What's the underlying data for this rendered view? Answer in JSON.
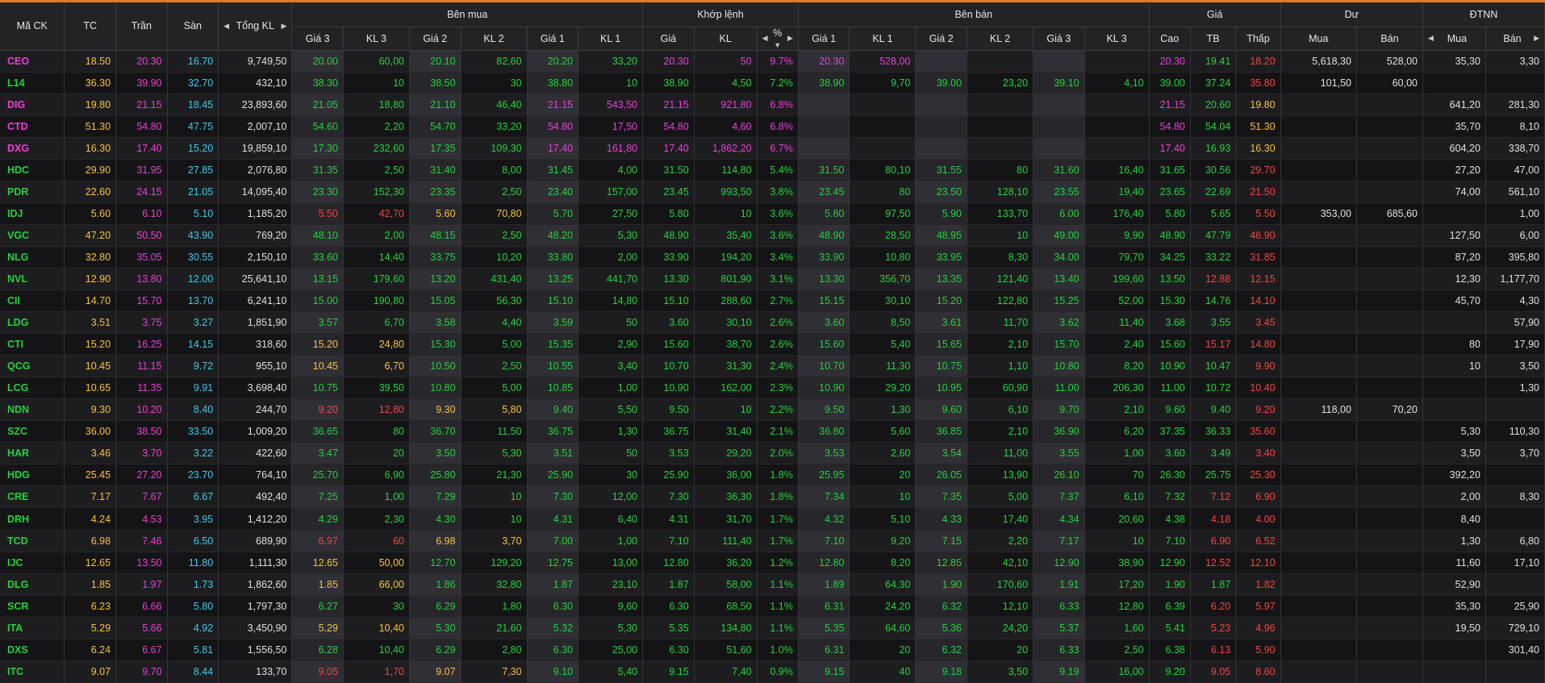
{
  "colors": {
    "ceiling": "#ee3dd9",
    "floor": "#3fc9e8",
    "ref": "#f7c23c",
    "up": "#26d13b",
    "down": "#f0463f",
    "accent": "#e8761f"
  },
  "headers": {
    "symbol": "Mã CK",
    "ref": "TC",
    "ceil": "Trần",
    "floor": "Sàn",
    "total": "Tổng KL",
    "buy": "Bên mua",
    "match": "Khớp lệnh",
    "sell": "Bên bán",
    "price": "Giá",
    "remain": "Dư",
    "foreign": "ĐTNN",
    "buy_cols": [
      "Giá 3",
      "KL 3",
      "Giá 2",
      "KL 2",
      "Giá 1",
      "KL 1"
    ],
    "match_cols": [
      "Giá",
      "KL",
      "%"
    ],
    "sell_cols": [
      "Giá 1",
      "KL 1",
      "Giá 2",
      "KL 2",
      "Giá 3",
      "KL 3"
    ],
    "price_cols": [
      "Cao",
      "TB",
      "Thấp"
    ],
    "remain_cols": [
      "Mua",
      "Bán"
    ],
    "foreign_cols": [
      "Mua",
      "Bán"
    ]
  },
  "rows": [
    {
      "s": "CEO",
      "tc": "18.50",
      "ce": "20.30",
      "fl": "16.70",
      "tot": "9,749,50",
      "b3": "20.00",
      "bk3": "60,00",
      "b2": "20.10",
      "bk2": "82,60",
      "b1": "20.20",
      "bk1": "33,20",
      "mp": "20.30",
      "mk": "50",
      "pct": "9.7%",
      "s1": "20.30",
      "sk1": "528,00",
      "s2": "",
      "sk2": "",
      "s3": "",
      "sk3": "",
      "hi": "20.30",
      "av": "19.41",
      "lo": "18.20",
      "rb": "5,618,30",
      "rs": "528,00",
      "fb": "35,30",
      "fs": "3,30"
    },
    {
      "s": "L14",
      "tc": "36.30",
      "ce": "39.90",
      "fl": "32.70",
      "tot": "432,10",
      "b3": "38.30",
      "bk3": "10",
      "b2": "38.50",
      "bk2": "30",
      "b1": "38.80",
      "bk1": "10",
      "mp": "38.90",
      "mk": "4,50",
      "pct": "7.2%",
      "s1": "38.90",
      "sk1": "9,70",
      "s2": "39.00",
      "sk2": "23,20",
      "s3": "39.10",
      "sk3": "4,10",
      "hi": "39.00",
      "av": "37.24",
      "lo": "35.80",
      "rb": "101,50",
      "rs": "60,00",
      "fb": "",
      "fs": ""
    },
    {
      "s": "DIG",
      "tc": "19.80",
      "ce": "21.15",
      "fl": "18.45",
      "tot": "23,893,60",
      "b3": "21.05",
      "bk3": "18,80",
      "b2": "21.10",
      "bk2": "46,40",
      "b1": "21.15",
      "bk1": "543,50",
      "mp": "21.15",
      "mk": "921,80",
      "pct": "6.8%",
      "s1": "",
      "sk1": "",
      "s2": "",
      "sk2": "",
      "s3": "",
      "sk3": "",
      "hi": "21.15",
      "av": "20.60",
      "lo": "19.80",
      "rb": "",
      "rs": "",
      "fb": "641,20",
      "fs": "281,30"
    },
    {
      "s": "CTD",
      "tc": "51.30",
      "ce": "54.80",
      "fl": "47.75",
      "tot": "2,007,10",
      "b3": "54.60",
      "bk3": "2,20",
      "b2": "54.70",
      "bk2": "33,20",
      "b1": "54.80",
      "bk1": "17,50",
      "mp": "54.80",
      "mk": "4,60",
      "pct": "6.8%",
      "s1": "",
      "sk1": "",
      "s2": "",
      "sk2": "",
      "s3": "",
      "sk3": "",
      "hi": "54.80",
      "av": "54.04",
      "lo": "51.30",
      "rb": "",
      "rs": "",
      "fb": "35,70",
      "fs": "8,10"
    },
    {
      "s": "DXG",
      "tc": "16.30",
      "ce": "17.40",
      "fl": "15.20",
      "tot": "19,859,10",
      "b3": "17.30",
      "bk3": "232,60",
      "b2": "17.35",
      "bk2": "109,30",
      "b1": "17.40",
      "bk1": "161,80",
      "mp": "17.40",
      "mk": "1,862,20",
      "pct": "6.7%",
      "s1": "",
      "sk1": "",
      "s2": "",
      "sk2": "",
      "s3": "",
      "sk3": "",
      "hi": "17.40",
      "av": "16.93",
      "lo": "16.30",
      "rb": "",
      "rs": "",
      "fb": "604,20",
      "fs": "338,70"
    },
    {
      "s": "HDC",
      "tc": "29.90",
      "ce": "31.95",
      "fl": "27.85",
      "tot": "2,076,80",
      "b3": "31.35",
      "bk3": "2,50",
      "b2": "31.40",
      "bk2": "8,00",
      "b1": "31.45",
      "bk1": "4,00",
      "mp": "31.50",
      "mk": "114,80",
      "pct": "5.4%",
      "s1": "31.50",
      "sk1": "80,10",
      "s2": "31.55",
      "sk2": "80",
      "s3": "31.60",
      "sk3": "16,40",
      "hi": "31.65",
      "av": "30.56",
      "lo": "29.70",
      "rb": "",
      "rs": "",
      "fb": "27,20",
      "fs": "47,00"
    },
    {
      "s": "PDR",
      "tc": "22.60",
      "ce": "24.15",
      "fl": "21.05",
      "tot": "14,095,40",
      "b3": "23.30",
      "bk3": "152,30",
      "b2": "23.35",
      "bk2": "2,50",
      "b1": "23.40",
      "bk1": "157,00",
      "mp": "23.45",
      "mk": "993,50",
      "pct": "3.8%",
      "s1": "23.45",
      "sk1": "80",
      "s2": "23.50",
      "sk2": "128,10",
      "s3": "23.55",
      "sk3": "19,40",
      "hi": "23.65",
      "av": "22.69",
      "lo": "21.50",
      "rb": "",
      "rs": "",
      "fb": "74,00",
      "fs": "561,10"
    },
    {
      "s": "IDJ",
      "tc": "5.60",
      "ce": "6.10",
      "fl": "5.10",
      "tot": "1,185,20",
      "b3": "5.50",
      "bk3": "42,70",
      "b2": "5.60",
      "bk2": "70,80",
      "b1": "5.70",
      "bk1": "27,50",
      "mp": "5.80",
      "mk": "10",
      "pct": "3.6%",
      "s1": "5.80",
      "sk1": "97,50",
      "s2": "5.90",
      "sk2": "133,70",
      "s3": "6.00",
      "sk3": "176,40",
      "hi": "5.80",
      "av": "5.65",
      "lo": "5.50",
      "rb": "353,00",
      "rs": "685,60",
      "fb": "",
      "fs": "1,00"
    },
    {
      "s": "VGC",
      "tc": "47.20",
      "ce": "50.50",
      "fl": "43.90",
      "tot": "769,20",
      "b3": "48.10",
      "bk3": "2,00",
      "b2": "48.15",
      "bk2": "2,50",
      "b1": "48.20",
      "bk1": "5,30",
      "mp": "48.90",
      "mk": "35,40",
      "pct": "3.6%",
      "s1": "48.90",
      "sk1": "28,50",
      "s2": "48.95",
      "sk2": "10",
      "s3": "49.00",
      "sk3": "9,90",
      "hi": "48.90",
      "av": "47.79",
      "lo": "46.90",
      "rb": "",
      "rs": "",
      "fb": "127,50",
      "fs": "6,00"
    },
    {
      "s": "NLG",
      "tc": "32.80",
      "ce": "35.05",
      "fl": "30.55",
      "tot": "2,150,10",
      "b3": "33.60",
      "bk3": "14,40",
      "b2": "33.75",
      "bk2": "10,20",
      "b1": "33.80",
      "bk1": "2,00",
      "mp": "33.90",
      "mk": "194,20",
      "pct": "3.4%",
      "s1": "33.90",
      "sk1": "10,80",
      "s2": "33.95",
      "sk2": "8,30",
      "s3": "34.00",
      "sk3": "79,70",
      "hi": "34.25",
      "av": "33.22",
      "lo": "31.85",
      "rb": "",
      "rs": "",
      "fb": "87,20",
      "fs": "395,80"
    },
    {
      "s": "NVL",
      "tc": "12.90",
      "ce": "13.80",
      "fl": "12.00",
      "tot": "25,641,10",
      "b3": "13.15",
      "bk3": "179,60",
      "b2": "13.20",
      "bk2": "431,40",
      "b1": "13.25",
      "bk1": "441,70",
      "mp": "13.30",
      "mk": "801,90",
      "pct": "3.1%",
      "s1": "13.30",
      "sk1": "356,70",
      "s2": "13.35",
      "sk2": "121,40",
      "s3": "13.40",
      "sk3": "199,60",
      "hi": "13.50",
      "av": "12.88",
      "lo": "12.15",
      "rb": "",
      "rs": "",
      "fb": "12,30",
      "fs": "1,177,70"
    },
    {
      "s": "CII",
      "tc": "14.70",
      "ce": "15.70",
      "fl": "13.70",
      "tot": "6,241,10",
      "b3": "15.00",
      "bk3": "190,80",
      "b2": "15.05",
      "bk2": "56,30",
      "b1": "15.10",
      "bk1": "14,80",
      "mp": "15.10",
      "mk": "288,60",
      "pct": "2.7%",
      "s1": "15.15",
      "sk1": "30,10",
      "s2": "15.20",
      "sk2": "122,80",
      "s3": "15.25",
      "sk3": "52,00",
      "hi": "15.30",
      "av": "14.76",
      "lo": "14.10",
      "rb": "",
      "rs": "",
      "fb": "45,70",
      "fs": "4,30"
    },
    {
      "s": "LDG",
      "tc": "3.51",
      "ce": "3.75",
      "fl": "3.27",
      "tot": "1,851,90",
      "b3": "3.57",
      "bk3": "6,70",
      "b2": "3.58",
      "bk2": "4,40",
      "b1": "3.59",
      "bk1": "50",
      "mp": "3.60",
      "mk": "30,10",
      "pct": "2.6%",
      "s1": "3.60",
      "sk1": "8,50",
      "s2": "3.61",
      "sk2": "11,70",
      "s3": "3.62",
      "sk3": "11,40",
      "hi": "3.68",
      "av": "3.55",
      "lo": "3.45",
      "rb": "",
      "rs": "",
      "fb": "",
      "fs": "57,90"
    },
    {
      "s": "CTI",
      "tc": "15.20",
      "ce": "16.25",
      "fl": "14.15",
      "tot": "318,60",
      "b3": "15.20",
      "bk3": "24,80",
      "b2": "15.30",
      "bk2": "5,00",
      "b1": "15.35",
      "bk1": "2,90",
      "mp": "15.60",
      "mk": "38,70",
      "pct": "2.6%",
      "s1": "15.60",
      "sk1": "5,40",
      "s2": "15.65",
      "sk2": "2,10",
      "s3": "15.70",
      "sk3": "2,40",
      "hi": "15.60",
      "av": "15.17",
      "lo": "14.80",
      "rb": "",
      "rs": "",
      "fb": "80",
      "fs": "17,90"
    },
    {
      "s": "QCG",
      "tc": "10.45",
      "ce": "11.15",
      "fl": "9.72",
      "tot": "955,10",
      "b3": "10.45",
      "bk3": "6,70",
      "b2": "10.50",
      "bk2": "2,50",
      "b1": "10.55",
      "bk1": "3,40",
      "mp": "10.70",
      "mk": "31,30",
      "pct": "2.4%",
      "s1": "10.70",
      "sk1": "11,30",
      "s2": "10.75",
      "sk2": "1,10",
      "s3": "10.80",
      "sk3": "8,20",
      "hi": "10.90",
      "av": "10.47",
      "lo": "9.90",
      "rb": "",
      "rs": "",
      "fb": "10",
      "fs": "3,50"
    },
    {
      "s": "LCG",
      "tc": "10.65",
      "ce": "11.35",
      "fl": "9.91",
      "tot": "3,698,40",
      "b3": "10.75",
      "bk3": "39,50",
      "b2": "10.80",
      "bk2": "5,00",
      "b1": "10.85",
      "bk1": "1,00",
      "mp": "10.90",
      "mk": "162,00",
      "pct": "2.3%",
      "s1": "10.90",
      "sk1": "29,20",
      "s2": "10.95",
      "sk2": "60,90",
      "s3": "11.00",
      "sk3": "206,30",
      "hi": "11.00",
      "av": "10.72",
      "lo": "10.40",
      "rb": "",
      "rs": "",
      "fb": "",
      "fs": "1,30"
    },
    {
      "s": "NDN",
      "tc": "9.30",
      "ce": "10.20",
      "fl": "8.40",
      "tot": "244,70",
      "b3": "9.20",
      "bk3": "12,80",
      "b2": "9.30",
      "bk2": "5,80",
      "b1": "9.40",
      "bk1": "5,50",
      "mp": "9.50",
      "mk": "10",
      "pct": "2.2%",
      "s1": "9.50",
      "sk1": "1,30",
      "s2": "9.60",
      "sk2": "6,10",
      "s3": "9.70",
      "sk3": "2,10",
      "hi": "9.60",
      "av": "9.40",
      "lo": "9.20",
      "rb": "118,00",
      "rs": "70,20",
      "fb": "",
      "fs": ""
    },
    {
      "s": "SZC",
      "tc": "36.00",
      "ce": "38.50",
      "fl": "33.50",
      "tot": "1,009,20",
      "b3": "36.65",
      "bk3": "80",
      "b2": "36.70",
      "bk2": "11,50",
      "b1": "36.75",
      "bk1": "1,30",
      "mp": "36.75",
      "mk": "31,40",
      "pct": "2.1%",
      "s1": "36.80",
      "sk1": "5,60",
      "s2": "36.85",
      "sk2": "2,10",
      "s3": "36.90",
      "sk3": "6,20",
      "hi": "37.35",
      "av": "36.33",
      "lo": "35.60",
      "rb": "",
      "rs": "",
      "fb": "5,30",
      "fs": "110,30"
    },
    {
      "s": "HAR",
      "tc": "3.46",
      "ce": "3.70",
      "fl": "3.22",
      "tot": "422,60",
      "b3": "3.47",
      "bk3": "20",
      "b2": "3.50",
      "bk2": "5,30",
      "b1": "3.51",
      "bk1": "50",
      "mp": "3.53",
      "mk": "29,20",
      "pct": "2.0%",
      "s1": "3.53",
      "sk1": "2,60",
      "s2": "3.54",
      "sk2": "11,00",
      "s3": "3.55",
      "sk3": "1,00",
      "hi": "3.60",
      "av": "3.49",
      "lo": "3.40",
      "rb": "",
      "rs": "",
      "fb": "3,50",
      "fs": "3,70"
    },
    {
      "s": "HDG",
      "tc": "25.45",
      "ce": "27.20",
      "fl": "23.70",
      "tot": "764,10",
      "b3": "25.70",
      "bk3": "6,90",
      "b2": "25.80",
      "bk2": "21,30",
      "b1": "25.90",
      "bk1": "30",
      "mp": "25.90",
      "mk": "36,00",
      "pct": "1.8%",
      "s1": "25.95",
      "sk1": "20",
      "s2": "26.05",
      "sk2": "13,90",
      "s3": "26.10",
      "sk3": "70",
      "hi": "26.30",
      "av": "25.75",
      "lo": "25.30",
      "rb": "",
      "rs": "",
      "fb": "392,20",
      "fs": ""
    },
    {
      "s": "CRE",
      "tc": "7.17",
      "ce": "7.67",
      "fl": "6.67",
      "tot": "492,40",
      "b3": "7.25",
      "bk3": "1,00",
      "b2": "7.29",
      "bk2": "10",
      "b1": "7.30",
      "bk1": "12,00",
      "mp": "7.30",
      "mk": "36,30",
      "pct": "1.8%",
      "s1": "7.34",
      "sk1": "10",
      "s2": "7.35",
      "sk2": "5,00",
      "s3": "7.37",
      "sk3": "6,10",
      "hi": "7.32",
      "av": "7.12",
      "lo": "6.90",
      "rb": "",
      "rs": "",
      "fb": "2,00",
      "fs": "8,30"
    },
    {
      "s": "DRH",
      "tc": "4.24",
      "ce": "4.53",
      "fl": "3.95",
      "tot": "1,412,20",
      "b3": "4.29",
      "bk3": "2,30",
      "b2": "4.30",
      "bk2": "10",
      "b1": "4.31",
      "bk1": "6,40",
      "mp": "4.31",
      "mk": "31,70",
      "pct": "1.7%",
      "s1": "4.32",
      "sk1": "5,10",
      "s2": "4.33",
      "sk2": "17,40",
      "s3": "4.34",
      "sk3": "20,60",
      "hi": "4.38",
      "av": "4.18",
      "lo": "4.00",
      "rb": "",
      "rs": "",
      "fb": "8,40",
      "fs": ""
    },
    {
      "s": "TCD",
      "tc": "6.98",
      "ce": "7.46",
      "fl": "6.50",
      "tot": "689,90",
      "b3": "6.97",
      "bk3": "60",
      "b2": "6.98",
      "bk2": "3,70",
      "b1": "7.00",
      "bk1": "1,00",
      "mp": "7.10",
      "mk": "111,40",
      "pct": "1.7%",
      "s1": "7.10",
      "sk1": "9,20",
      "s2": "7.15",
      "sk2": "2,20",
      "s3": "7.17",
      "sk3": "10",
      "hi": "7.10",
      "av": "6.90",
      "lo": "6.52",
      "rb": "",
      "rs": "",
      "fb": "1,30",
      "fs": "6,80"
    },
    {
      "s": "IJC",
      "tc": "12.65",
      "ce": "13.50",
      "fl": "11.80",
      "tot": "1,111,30",
      "b3": "12.65",
      "bk3": "50,00",
      "b2": "12.70",
      "bk2": "129,20",
      "b1": "12.75",
      "bk1": "13,00",
      "mp": "12.80",
      "mk": "36,20",
      "pct": "1.2%",
      "s1": "12.80",
      "sk1": "8,20",
      "s2": "12.85",
      "sk2": "42,10",
      "s3": "12.90",
      "sk3": "38,90",
      "hi": "12.90",
      "av": "12.52",
      "lo": "12.10",
      "rb": "",
      "rs": "",
      "fb": "11,60",
      "fs": "17,10"
    },
    {
      "s": "DLG",
      "tc": "1.85",
      "ce": "1.97",
      "fl": "1.73",
      "tot": "1,862,60",
      "b3": "1.85",
      "bk3": "66,00",
      "b2": "1.86",
      "bk2": "32,80",
      "b1": "1.87",
      "bk1": "23,10",
      "mp": "1.87",
      "mk": "58,00",
      "pct": "1.1%",
      "s1": "1.89",
      "sk1": "64,30",
      "s2": "1.90",
      "sk2": "170,60",
      "s3": "1.91",
      "sk3": "17,20",
      "hi": "1.90",
      "av": "1.87",
      "lo": "1.82",
      "rb": "",
      "rs": "",
      "fb": "52,90",
      "fs": ""
    },
    {
      "s": "SCR",
      "tc": "6.23",
      "ce": "6.66",
      "fl": "5.80",
      "tot": "1,797,30",
      "b3": "6.27",
      "bk3": "30",
      "b2": "6.29",
      "bk2": "1,80",
      "b1": "6.30",
      "bk1": "9,60",
      "mp": "6.30",
      "mk": "68,50",
      "pct": "1.1%",
      "s1": "6.31",
      "sk1": "24,20",
      "s2": "6.32",
      "sk2": "12,10",
      "s3": "6.33",
      "sk3": "12,80",
      "hi": "6.39",
      "av": "6.20",
      "lo": "5.97",
      "rb": "",
      "rs": "",
      "fb": "35,30",
      "fs": "25,90"
    },
    {
      "s": "ITA",
      "tc": "5.29",
      "ce": "5.66",
      "fl": "4.92",
      "tot": "3,450,90",
      "b3": "5.29",
      "bk3": "10,40",
      "b2": "5.30",
      "bk2": "21,60",
      "b1": "5.32",
      "bk1": "5,30",
      "mp": "5.35",
      "mk": "134,80",
      "pct": "1.1%",
      "s1": "5.35",
      "sk1": "64,60",
      "s2": "5.36",
      "sk2": "24,20",
      "s3": "5.37",
      "sk3": "1,60",
      "hi": "5.41",
      "av": "5.23",
      "lo": "4.96",
      "rb": "",
      "rs": "",
      "fb": "19,50",
      "fs": "729,10"
    },
    {
      "s": "DXS",
      "tc": "6.24",
      "ce": "6.67",
      "fl": "5.81",
      "tot": "1,556,50",
      "b3": "6.28",
      "bk3": "10,40",
      "b2": "6.29",
      "bk2": "2,80",
      "b1": "6.30",
      "bk1": "25,00",
      "mp": "6.30",
      "mk": "51,60",
      "pct": "1.0%",
      "s1": "6.31",
      "sk1": "20",
      "s2": "6.32",
      "sk2": "20",
      "s3": "6.33",
      "sk3": "2,50",
      "hi": "6.38",
      "av": "6.13",
      "lo": "5.90",
      "rb": "",
      "rs": "",
      "fb": "",
      "fs": "301,40"
    },
    {
      "s": "ITC",
      "tc": "9.07",
      "ce": "9.70",
      "fl": "8.44",
      "tot": "133,70",
      "b3": "9.05",
      "bk3": "1,70",
      "b2": "9.07",
      "bk2": "7,30",
      "b1": "9.10",
      "bk1": "5,40",
      "mp": "9.15",
      "mk": "7,40",
      "pct": "0.9%",
      "s1": "9.15",
      "sk1": "40",
      "s2": "9.18",
      "sk2": "3,50",
      "s3": "9.19",
      "sk3": "16,00",
      "hi": "9.20",
      "av": "9.05",
      "lo": "8.60",
      "rb": "",
      "rs": "",
      "fb": "",
      "fs": ""
    }
  ]
}
